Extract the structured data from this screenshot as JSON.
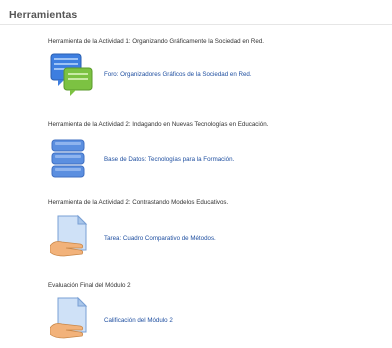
{
  "block": {
    "title": "Herramientas"
  },
  "activities": [
    {
      "description": "Herramienta de la Actividad 1: Organizando Gráficamente la Sociedad en Red.",
      "icon": "forum-icon",
      "link": "Foro: Organizadores Gráficos de la Sociedad en Red."
    },
    {
      "description": "Herramienta de la Actividad 2: Indagando en Nuevas Tecnologías en Educación.",
      "icon": "database-icon",
      "link": "Base de Datos: Tecnologías para la Formación."
    },
    {
      "description": "Herramienta de la Actividad 2: Contrastando Modelos Educativos.",
      "icon": "assignment-icon",
      "link": "Tarea: Cuadro Comparativo de Métodos."
    },
    {
      "description": "Evaluación Final del Módulo 2",
      "icon": "assignment-icon",
      "link": "Calificación del Módulo 2"
    }
  ],
  "colors": {
    "link": "#1f4fa0",
    "forum_blue": "#3d7ee0",
    "forum_green": "#7cc242",
    "database_blue": "#5b8fe0",
    "hand": "#f2b27a"
  }
}
